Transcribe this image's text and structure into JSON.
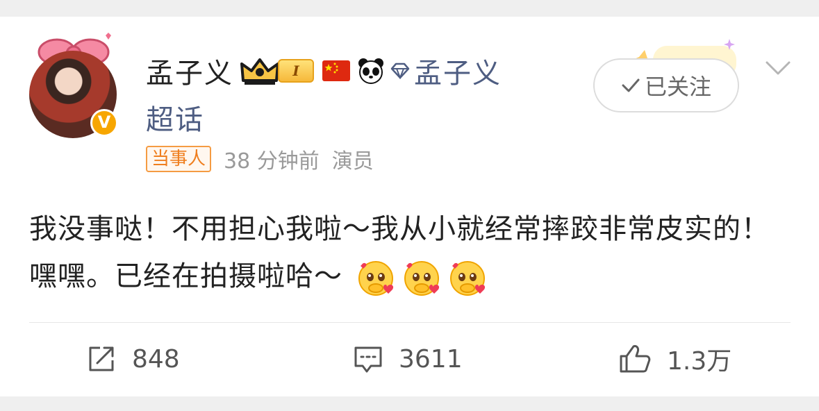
{
  "post": {
    "username": "孟子义",
    "level_badge": "I",
    "topic_link_1": "孟子义",
    "topic_link_2": "超话",
    "party_tag": "当事人",
    "time": "38 分钟前",
    "role": "演员",
    "follow_label": "已关注",
    "text": "我没事哒！不用担心我啦～我从小就经常摔跤非常皮实的！嘿嘿。已经在拍摄啦哈～",
    "emoji_count": 3
  },
  "actions": {
    "repost_count": "848",
    "comment_count": "3611",
    "like_count": "1.3万"
  },
  "icons": [
    "bow-icon",
    "verified-v-icon",
    "crown-icon",
    "flag-icon",
    "panda-icon",
    "diamond-icon",
    "check-icon",
    "chevron-down-icon",
    "repost-icon",
    "comment-icon",
    "like-icon",
    "emoji-icon"
  ],
  "colors": {
    "link": "#4e5d82",
    "tag_orange": "#ef7e1e",
    "verified_gold": "#f7a600",
    "background": "#efefef"
  }
}
